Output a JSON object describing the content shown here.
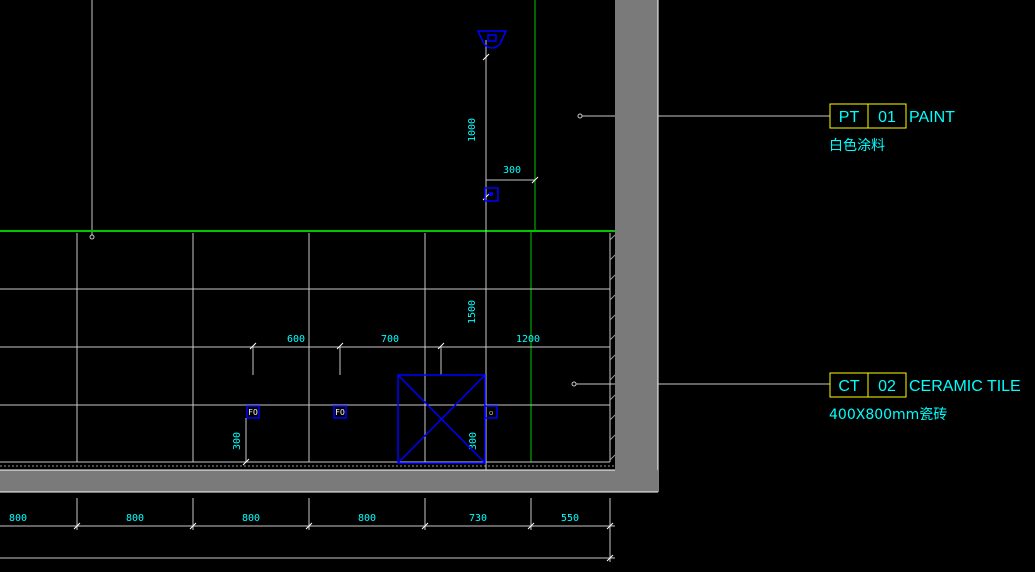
{
  "colors": {
    "background": "#000000",
    "grid": "#c8c8c8",
    "wall": "#7a7a7a",
    "floor_line": "#00c800",
    "fixture": "#0000ff",
    "text": "#00ffff",
    "tag_box": "#ffff00"
  },
  "labels": {
    "paint": {
      "code": "PT",
      "number": "01",
      "name": "PAINT",
      "note": "白色涂料"
    },
    "tile": {
      "code": "CT",
      "number": "02",
      "name": "CERAMIC TILE",
      "note": "400X800mm瓷砖"
    }
  },
  "dimensions": {
    "vertical": {
      "lamp_height": "1000",
      "switch_offset": "300",
      "grid_height": "1500",
      "outlet_height_left": "300",
      "outlet_height_right": "300"
    },
    "horizontal_spacing": {
      "s1": "600",
      "s2": "700",
      "s3": "1200"
    },
    "bottom_row": [
      "800",
      "800",
      "800",
      "800",
      "730",
      "550"
    ]
  },
  "symbols": {
    "outlet_a": "FO",
    "outlet_b": "FO",
    "outlet_c": "▫"
  },
  "icons": [
    "wall-lamp-icon",
    "switch-icon",
    "outlet-icon",
    "access-panel-icon"
  ]
}
